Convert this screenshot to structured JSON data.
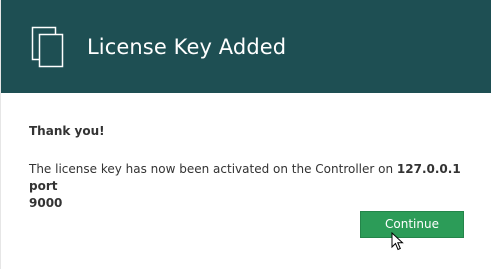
{
  "dialog": {
    "title": "License Key Added",
    "title_icon": "documents-icon",
    "greeting": "Thank you!",
    "message_prefix": "The license key has now been activated on the Controller on ",
    "message_host": "127.0.0.1",
    "message_port_label": "port",
    "message_port": "9000",
    "continue_label": "Continue"
  },
  "colors": {
    "header_bg": "#1e4f53",
    "button_bg": "#2c9c58",
    "text": "#333333"
  }
}
